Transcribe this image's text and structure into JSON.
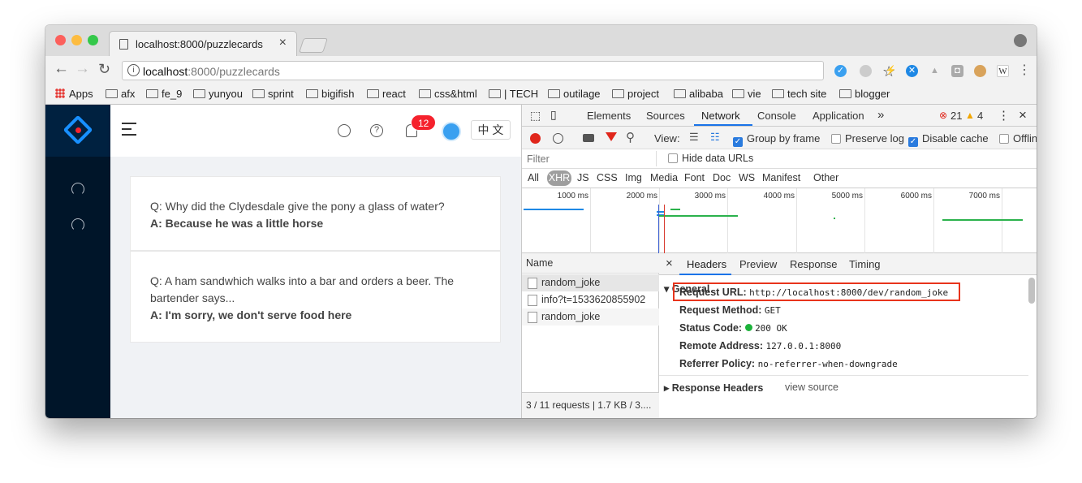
{
  "browser": {
    "tab_title": "localhost:8000/puzzlecards",
    "tab_close": "×",
    "url_host": "localhost",
    "url_rest": ":8000/puzzlecards",
    "bookmarks": [
      "Apps",
      "afx",
      "fe_9",
      "yunyou",
      "sprint",
      "bigifish",
      "react",
      "css&html",
      "| TECH",
      "outilage",
      "project",
      "alibaba",
      "vie",
      "tech site",
      "blogger"
    ],
    "ext_w": "W"
  },
  "app": {
    "notification_count": "12",
    "lang_label": "中 文",
    "cards": [
      {
        "q": "Q: Why did the Clydesdale give the pony a glass of water?",
        "a": "A: Because he was a little horse"
      },
      {
        "q": "Q: A ham sandwhich walks into a bar and orders a beer. The bartender says...",
        "a": "A: I'm sorry, we don't serve food here"
      }
    ]
  },
  "devtools": {
    "tabs": [
      "Elements",
      "Sources",
      "Network",
      "Console",
      "Application"
    ],
    "more": "»",
    "errors": "21",
    "warnings": "4",
    "close": "×",
    "view_label": "View:",
    "group_by_frame": "Group by frame",
    "preserve_log": "Preserve log",
    "disable_cache": "Disable cache",
    "offline": "Offlin",
    "filter_placeholder": "Filter",
    "hide_data_urls": "Hide data URLs",
    "types": [
      "All",
      "XHR",
      "JS",
      "CSS",
      "Img",
      "Media",
      "Font",
      "Doc",
      "WS",
      "Manifest",
      "Other"
    ],
    "timeline_ticks": [
      "1000 ms",
      "2000 ms",
      "3000 ms",
      "4000 ms",
      "5000 ms",
      "6000 ms",
      "7000 ms"
    ],
    "name_header": "Name",
    "requests": [
      "random_joke",
      "info?t=1533620855902",
      "random_joke"
    ],
    "summary": "3 / 11 requests | 1.7 KB / 3....",
    "detail_close": "×",
    "detail_tabs": [
      "Headers",
      "Preview",
      "Response",
      "Timing"
    ],
    "general_label": "General",
    "general": [
      {
        "k": "Request URL:",
        "v": "http://localhost:8000/dev/random_joke"
      },
      {
        "k": "Request Method:",
        "v": "GET"
      },
      {
        "k": "Status Code:",
        "v": "200 OK"
      },
      {
        "k": "Remote Address:",
        "v": "127.0.0.1:8000"
      },
      {
        "k": "Referrer Policy:",
        "v": "no-referrer-when-downgrade"
      }
    ],
    "response_headers_label": "Response Headers",
    "view_source": "view source",
    "colors": {
      "active_tab": "#1a73e8",
      "record": "#e0261b",
      "highlight": "#e8341c",
      "status_ok": "#1db33b"
    }
  }
}
